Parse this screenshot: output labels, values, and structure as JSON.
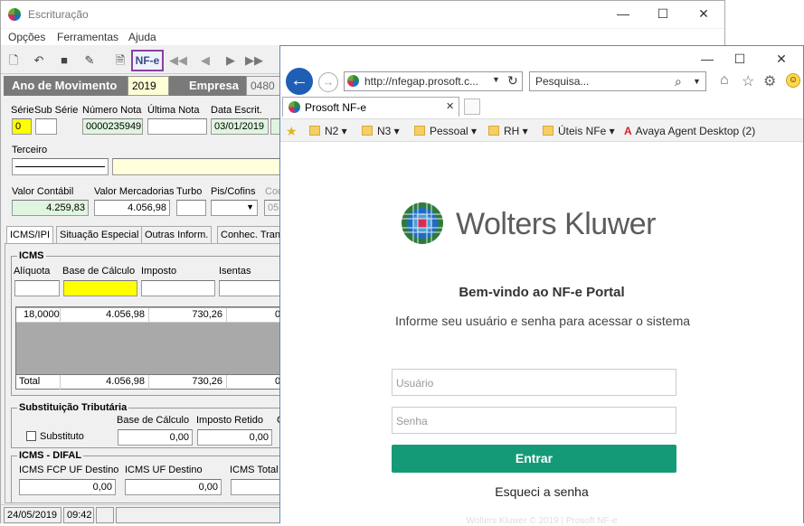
{
  "escrituracao": {
    "window_title": "Escrituração",
    "controls": {
      "minimize": "—",
      "maximize": "☐",
      "close": "✕"
    },
    "menu": [
      "Opções",
      "Ferramentas",
      "Ajuda"
    ],
    "nfe_button": "NF-e",
    "year_bar": {
      "ano_label": "Ano de Movimento",
      "ano_value": "2019",
      "empresa_label": "Empresa",
      "empresa_value": "0480"
    },
    "fields": {
      "serie_label": "Série",
      "serie_value": "0",
      "sub_serie_label": "Sub Série",
      "sub_serie_value": "",
      "numero_nota_label": "Número Nota",
      "numero_nota_value": "0000235949",
      "ultima_nota_label": "Última Nota",
      "ultima_nota_value": "",
      "data_escrit_label": "Data Escrit.",
      "data_escrit_value": "03/01/2019",
      "data_doc_label": "Data Doc.",
      "data_doc_value": "",
      "terceiro_label": "Terceiro",
      "valor_contabil_label": "Valor Contábil",
      "valor_contabil_value": "4.259,83",
      "valor_mercadorias_label": "Valor Mercadorias",
      "valor_mercadorias_value": "4.056,98",
      "turbo_label": "Turbo",
      "pis_cofins_label": "Pis/Cofins",
      "cod_label": "Cod",
      "cod_value": "05"
    },
    "tabs": [
      "ICMS/IPI",
      "Situação Especial",
      "Outras Inform.",
      "Conhec. Tran"
    ],
    "icms": {
      "title": "ICMS",
      "columns": [
        "Alíquota",
        "Base de Cálculo",
        "Imposto",
        "Isentas"
      ],
      "rows": [
        {
          "aliquota": "18,0000",
          "base": "4.056,98",
          "imposto": "730,26",
          "isentas": "0"
        }
      ],
      "total": {
        "label": "Total",
        "base": "4.056,98",
        "imposto": "730,26",
        "isentas": "0"
      }
    },
    "st": {
      "title": "Substituição Tributária",
      "checkbox_label": "Substituto",
      "base_label": "Base de Cálculo",
      "base_value": "0,00",
      "imposto_label": "Imposto Retido",
      "imposto_value": "0,00",
      "extra_label": "C"
    },
    "difal": {
      "title": "ICMS - DIFAL",
      "fcp_label": "ICMS FCP UF Destino",
      "fcp_value": "0,00",
      "uf_label": "ICMS UF Destino",
      "uf_value": "0,00",
      "total_label": "ICMS Total"
    },
    "status": {
      "date": "24/05/2019",
      "time": "09:42"
    }
  },
  "browser": {
    "controls": {
      "minimize": "—",
      "maximize": "☐",
      "close": "✕"
    },
    "address": "http://nfegap.prosoft.c...",
    "search_placeholder": "Pesquisa...",
    "tab_title": "Prosoft NF-e",
    "favorites": [
      "N2",
      "N3",
      "Pessoal",
      "RH",
      "Úteis NFe"
    ],
    "avaya": "Avaya Agent Desktop (2)",
    "brand": "Wolters Kluwer",
    "welcome": "Bem-vindo ao NF-e Portal",
    "subtitle": "Informe seu usuário e senha para acessar o sistema",
    "user_placeholder": "Usuário",
    "password_placeholder": "Senha",
    "login_button": "Entrar",
    "forgot": "Esqueci a senha",
    "footer": "Wolters Kluwer © 2019 | Prosoft NF-e"
  }
}
